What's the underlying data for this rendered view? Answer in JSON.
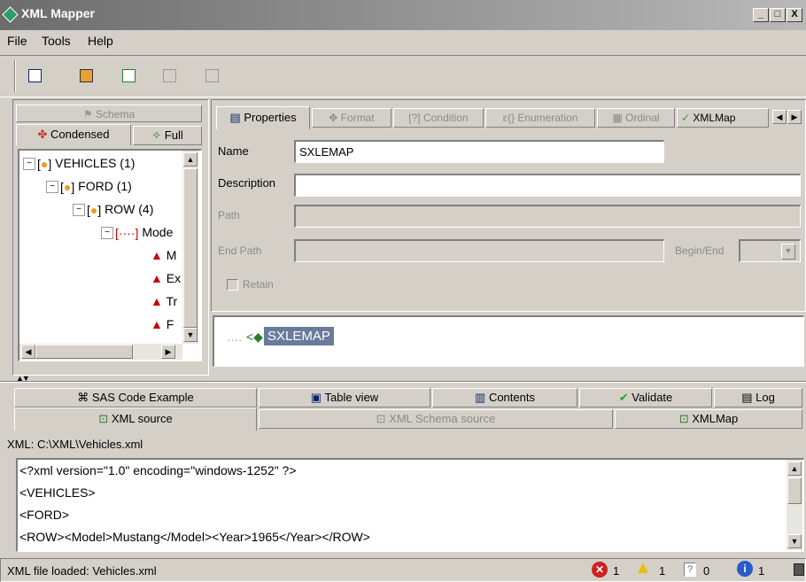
{
  "window": {
    "title": "XML Mapper",
    "controls": [
      "_",
      "□",
      "X"
    ]
  },
  "menu": [
    "File",
    "Tools",
    "Help"
  ],
  "toolbar": {
    "buttons": [
      "open-xml-icon",
      "open-schema-icon",
      "open-map-icon",
      "save-icon",
      "save-as-icon"
    ]
  },
  "left_panel": {
    "top_tab": "Schema",
    "tabs": [
      "Condensed",
      "Full"
    ],
    "tree": [
      {
        "label": "VEHICLES (1)",
        "level": 0
      },
      {
        "label": "FORD (1)",
        "level": 1
      },
      {
        "label": "ROW (4)",
        "level": 2
      },
      {
        "label": "Mode",
        "level": 3
      },
      {
        "label": "M",
        "level": 4
      },
      {
        "label": "Ex",
        "level": 4
      },
      {
        "label": "Tr",
        "level": 4
      },
      {
        "label": "F",
        "level": 4
      }
    ]
  },
  "properties": {
    "tabs": [
      "Properties",
      "Format",
      "Condition",
      "Enumeration",
      "Ordinal",
      "XMLMap"
    ],
    "name_label": "Name",
    "name_value": "SXLEMAP",
    "description_label": "Description",
    "description_value": "",
    "path_label": "Path",
    "end_path_label": "End Path",
    "begin_end_label": "Begin/End",
    "retain_label": "Retain"
  },
  "map_tree": {
    "label": "SXLEMAP"
  },
  "bottom_tabs": {
    "row1": [
      "SAS Code Example",
      "Table view",
      "Contents",
      "Validate",
      "Log"
    ],
    "row2": [
      "XML source",
      "XML Schema source",
      "XMLMap"
    ]
  },
  "xml_path": "XML: C:\\XML\\Vehicles.xml",
  "xml_lines": [
    "<?xml version=\"1.0\" encoding=\"windows-1252\" ?>",
    "<VEHICLES>",
    "<FORD>",
    "<ROW><Model>Mustang</Model><Year>1965</Year></ROW>"
  ],
  "status": {
    "message": "XML file loaded: Vehicles.xml",
    "errors": "1",
    "warnings": "1",
    "questions": "0",
    "info": "1"
  },
  "colors": {
    "title_gradient_start": "#6c6c6c",
    "selection": "#0a246a",
    "selection_map": "#6a7a9a"
  }
}
